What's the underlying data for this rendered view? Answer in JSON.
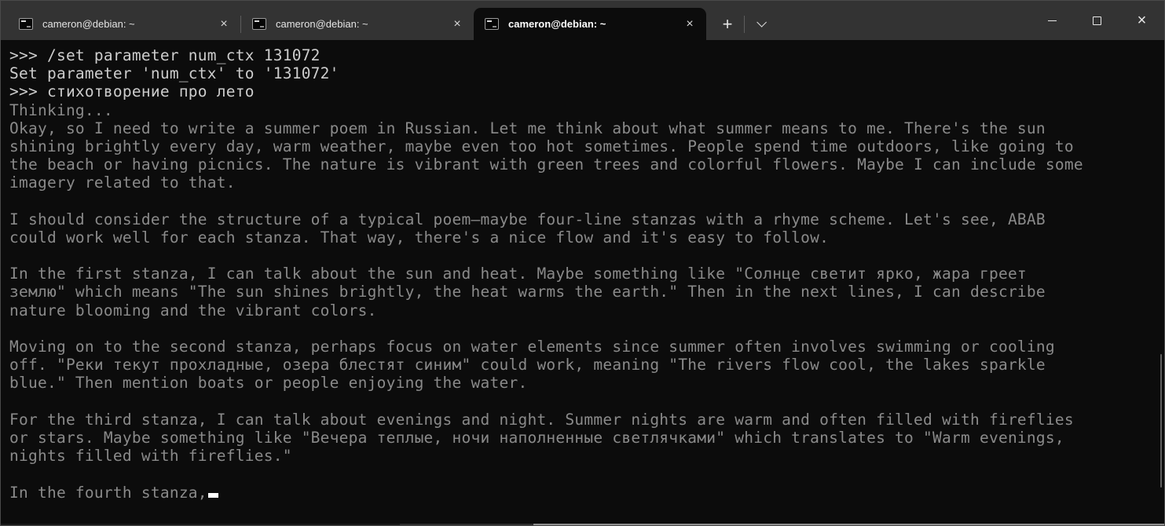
{
  "window": {
    "tabs": [
      {
        "title": "cameron@debian: ~",
        "active": false
      },
      {
        "title": "cameron@debian: ~",
        "active": false
      },
      {
        "title": "cameron@debian: ~",
        "active": true
      }
    ],
    "tab_actions": {
      "close_tab": "×",
      "new_tab": "+",
      "dropdown": "chevron-down-icon"
    },
    "controls": {
      "minimize": "minimize-bar-icon",
      "maximize": "maximize-square-icon",
      "close": "×"
    }
  },
  "colors": {
    "titlebar_bg": "#333333",
    "terminal_bg": "#0c0c0c",
    "text_bright": "#cccccc",
    "text_dim": "#8a8a8a",
    "cursor": "#ffffff"
  },
  "terminal": {
    "lines": [
      {
        "style": "bright",
        "text": ">>> /set parameter num_ctx 131072"
      },
      {
        "style": "bright",
        "text": "Set parameter 'num_ctx' to '131072'"
      },
      {
        "style": "bright",
        "text": ">>> стихотворение про лето"
      },
      {
        "style": "dim",
        "text": "Thinking..."
      },
      {
        "style": "dim",
        "text": "Okay, so I need to write a summer poem in Russian. Let me think about what summer means to me. There's the sun"
      },
      {
        "style": "dim",
        "text": "shining brightly every day, warm weather, maybe even too hot sometimes. People spend time outdoors, like going to"
      },
      {
        "style": "dim",
        "text": "the beach or having picnics. The nature is vibrant with green trees and colorful flowers. Maybe I can include some"
      },
      {
        "style": "dim",
        "text": "imagery related to that."
      },
      {
        "style": "dim",
        "text": ""
      },
      {
        "style": "dim",
        "text": "I should consider the structure of a typical poem—maybe four-line stanzas with a rhyme scheme. Let's see, ABAB"
      },
      {
        "style": "dim",
        "text": "could work well for each stanza. That way, there's a nice flow and it's easy to follow."
      },
      {
        "style": "dim",
        "text": ""
      },
      {
        "style": "dim",
        "text": "In the first stanza, I can talk about the sun and heat. Maybe something like \"Солнце светит ярко, жара греет"
      },
      {
        "style": "dim",
        "text": "землю\" which means \"The sun shines brightly, the heat warms the earth.\" Then in the next lines, I can describe"
      },
      {
        "style": "dim",
        "text": "nature blooming and the vibrant colors."
      },
      {
        "style": "dim",
        "text": ""
      },
      {
        "style": "dim",
        "text": "Moving on to the second stanza, perhaps focus on water elements since summer often involves swimming or cooling"
      },
      {
        "style": "dim",
        "text": "off. \"Реки текут прохладные, озера блестят синим\" could work, meaning \"The rivers flow cool, the lakes sparkle"
      },
      {
        "style": "dim",
        "text": "blue.\" Then mention boats or people enjoying the water."
      },
      {
        "style": "dim",
        "text": ""
      },
      {
        "style": "dim",
        "text": "For the third stanza, I can talk about evenings and night. Summer nights are warm and often filled with fireflies"
      },
      {
        "style": "dim",
        "text": "or stars. Maybe something like \"Вечера теплые, ночи наполненные светлячками\" which translates to \"Warm evenings,"
      },
      {
        "style": "dim",
        "text": "nights filled with fireflies.\""
      },
      {
        "style": "dim",
        "text": ""
      },
      {
        "style": "dim",
        "text": "In the fourth stanza,",
        "cursor": true
      }
    ]
  }
}
